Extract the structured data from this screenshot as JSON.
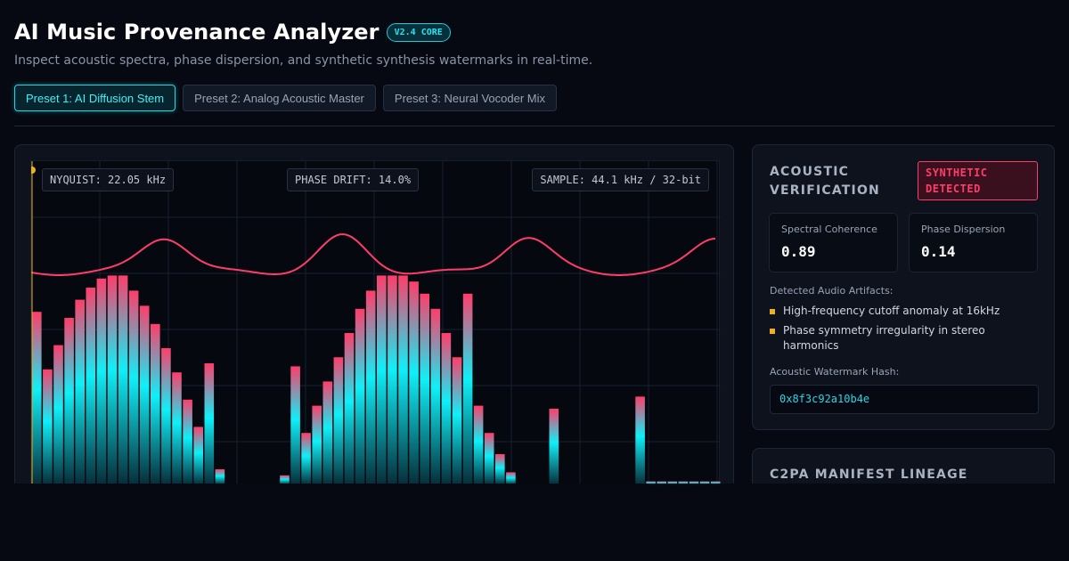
{
  "header": {
    "title": "AI Music Provenance Analyzer",
    "version_badge": "V2.4 CORE",
    "subtitle": "Inspect acoustic spectra, phase dispersion, and synthetic synthesis watermarks in real-time."
  },
  "presets": [
    {
      "label": "Preset 1: AI Diffusion Stem",
      "active": true
    },
    {
      "label": "Preset 2: Analog Acoustic Master",
      "active": false
    },
    {
      "label": "Preset 3: Neural Vocoder Mix",
      "active": false
    }
  ],
  "visualizer": {
    "nyquist": "NYQUIST: 22.05 kHz",
    "phase_drift": "PHASE DRIFT: 14.0%",
    "sample": "SAMPLE: 44.1 kHz / 32-bit",
    "bar_levels": [
      0.57,
      0.38,
      0.46,
      0.55,
      0.61,
      0.65,
      0.68,
      0.69,
      0.69,
      0.64,
      0.59,
      0.53,
      0.45,
      0.37,
      0.28,
      0.19,
      0.4,
      0.05,
      0,
      0,
      0,
      0,
      0,
      0.03,
      0.39,
      0.17,
      0.26,
      0.34,
      0.42,
      0.5,
      0.58,
      0.64,
      0.69,
      0.69,
      0.69,
      0.67,
      0.63,
      0.58,
      0.5,
      0.42,
      0.63,
      0.26,
      0.17,
      0.1,
      0.04,
      0,
      0,
      0,
      0.25,
      0,
      0,
      0,
      0,
      0,
      0,
      0,
      0.29,
      0.01,
      0.01,
      0.01,
      0.01,
      0.01,
      0.01,
      0.01
    ],
    "colors": {
      "bar_top": "#ff3d6a",
      "bar_mid": "#0ff0f8",
      "bar_bottom": "#062e3a",
      "wave": "#ff3d6a",
      "marker": "#f0b01e"
    }
  },
  "verification": {
    "title": "ACOUSTIC VERIFICATION",
    "status": "SYNTHETIC DETECTED",
    "metrics": [
      {
        "label": "Spectral Coherence",
        "value": "0.89"
      },
      {
        "label": "Phase Dispersion",
        "value": "0.14"
      }
    ],
    "artifacts_label": "Detected Audio Artifacts:",
    "artifacts": [
      "High-frequency cutoff anomaly at 16kHz",
      "Phase symmetry irregularity in stereo harmonics"
    ],
    "watermark_label": "Acoustic Watermark Hash:",
    "watermark_hash": "0x8f3c92a10b4e"
  },
  "c2pa": {
    "title": "C2PA MANIFEST LINEAGE"
  }
}
